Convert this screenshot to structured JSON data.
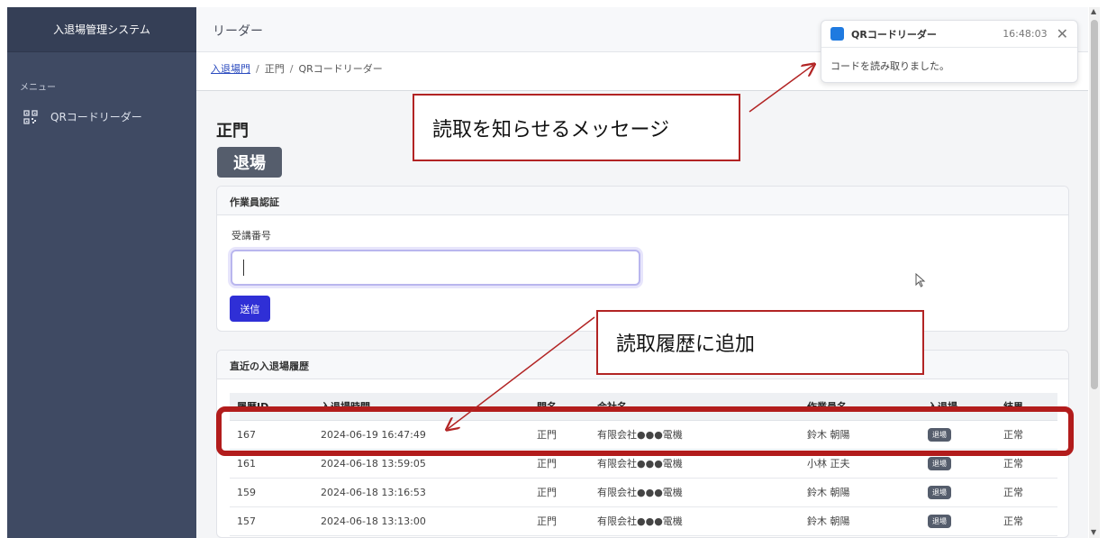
{
  "sidebar": {
    "brand": "入退場管理システム",
    "section_label": "メニュー",
    "items": [
      {
        "label": "QRコードリーダー",
        "icon": "qr-code-icon"
      }
    ]
  },
  "header": {
    "title": "リーダー"
  },
  "breadcrumb": {
    "root": "入退場門",
    "sep": "/",
    "gate": "正門",
    "current": "QRコードリーダー"
  },
  "main": {
    "gate_title": "正門",
    "direction": "退場"
  },
  "auth_card": {
    "title": "作業員認証",
    "field_label": "受講番号",
    "input_value": "",
    "submit_label": "送信"
  },
  "history_card": {
    "title": "直近の入退場履歴",
    "columns": [
      "履歴ID",
      "入退場時間",
      "門名",
      "会社名",
      "作業員名",
      "入退場",
      "結果"
    ],
    "rows": [
      {
        "id": "167",
        "time": "2024-06-19 16:47:49",
        "gate": "正門",
        "company": "有限会社●●●電機",
        "worker": "鈴木 朝陽",
        "direction": "退場",
        "result": "正常"
      },
      {
        "id": "161",
        "time": "2024-06-18 13:59:05",
        "gate": "正門",
        "company": "有限会社●●●電機",
        "worker": "小林 正夫",
        "direction": "退場",
        "result": "正常"
      },
      {
        "id": "159",
        "time": "2024-06-18 13:16:53",
        "gate": "正門",
        "company": "有限会社●●●電機",
        "worker": "鈴木 朝陽",
        "direction": "退場",
        "result": "正常"
      },
      {
        "id": "157",
        "time": "2024-06-18 13:13:00",
        "gate": "正門",
        "company": "有限会社●●●電機",
        "worker": "鈴木 朝陽",
        "direction": "退場",
        "result": "正常"
      }
    ]
  },
  "toast": {
    "title": "QRコードリーダー",
    "time": "16:48:03",
    "message": "コードを読み取りました。"
  },
  "annotations": {
    "message_callout": "読取を知らせるメッセージ",
    "history_callout": "読取履歴に追加"
  },
  "colors": {
    "sidebar": "#3f4a63",
    "accent": "#2f2fd6",
    "badge": "#555d6c",
    "annotation": "#b22424"
  }
}
